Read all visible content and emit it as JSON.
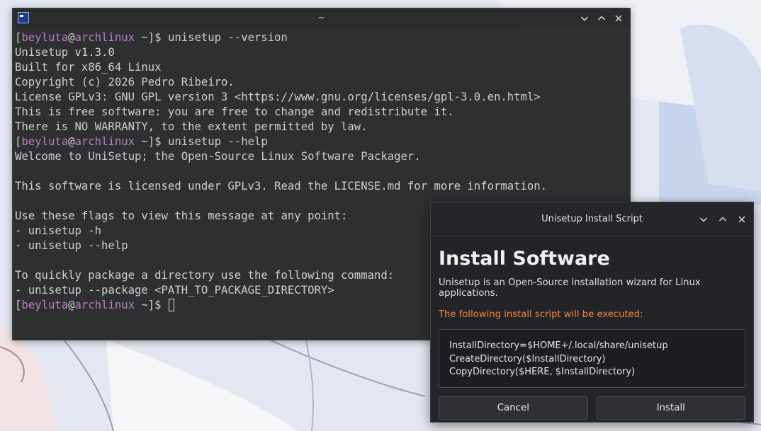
{
  "terminal": {
    "title": "~",
    "icon": "terminal-app-icon",
    "controls": [
      "minimize-icon",
      "maximize-icon",
      "close-icon"
    ],
    "prompt": {
      "open": "[",
      "user": "beyluta",
      "at": "@",
      "host": "archlinux",
      "path": " ~]$ "
    },
    "lines": [
      {
        "type": "prompt",
        "cmd": "unisetup --version"
      },
      {
        "type": "out",
        "text": "Unisetup v1.3.0"
      },
      {
        "type": "out",
        "text": "Built for x86_64 Linux"
      },
      {
        "type": "out",
        "text": "Copyright (c) 2026 Pedro Ribeiro."
      },
      {
        "type": "out",
        "text": "License GPLv3: GNU GPL version 3 <https://www.gnu.org/licenses/gpl-3.0.en.html>"
      },
      {
        "type": "out",
        "text": "This is free software: you are free to change and redistribute it."
      },
      {
        "type": "out",
        "text": "There is NO WARRANTY, to the extent permitted by law."
      },
      {
        "type": "prompt",
        "cmd": "unisetup --help"
      },
      {
        "type": "out",
        "text": "Welcome to UniSetup; the Open-Source Linux Software Packager."
      },
      {
        "type": "out",
        "text": ""
      },
      {
        "type": "out",
        "text": "This software is licensed under GPLv3. Read the LICENSE.md for more information."
      },
      {
        "type": "out",
        "text": ""
      },
      {
        "type": "out",
        "text": "Use these flags to view this message at any point:"
      },
      {
        "type": "out",
        "text": "- unisetup -h"
      },
      {
        "type": "out",
        "text": "- unisetup --help"
      },
      {
        "type": "out",
        "text": ""
      },
      {
        "type": "out",
        "text": "To quickly package a directory use the following command:"
      },
      {
        "type": "out",
        "text": "- unisetup --package <PATH_TO_PACKAGE_DIRECTORY>"
      },
      {
        "type": "prompt",
        "cmd": "",
        "cursor": true
      }
    ]
  },
  "dialog": {
    "title": "Unisetup Install Script",
    "heading": "Install Software",
    "description": "Unisetup is an Open-Source installation wizard for Linux applications.",
    "warning": "The following install script will be executed:",
    "script": [
      "InstallDirectory=$HOME+/.local/share/unisetup",
      "CreateDirectory($InstallDirectory)",
      "CopyDirectory($HERE, $InstallDirectory)"
    ],
    "cancel_label": "Cancel",
    "install_label": "Install"
  },
  "colors": {
    "prompt_accent": "#b87fc3",
    "warning": "#f2853a",
    "terminal_bg": "#1e1f21",
    "dialog_bg": "#232427"
  }
}
